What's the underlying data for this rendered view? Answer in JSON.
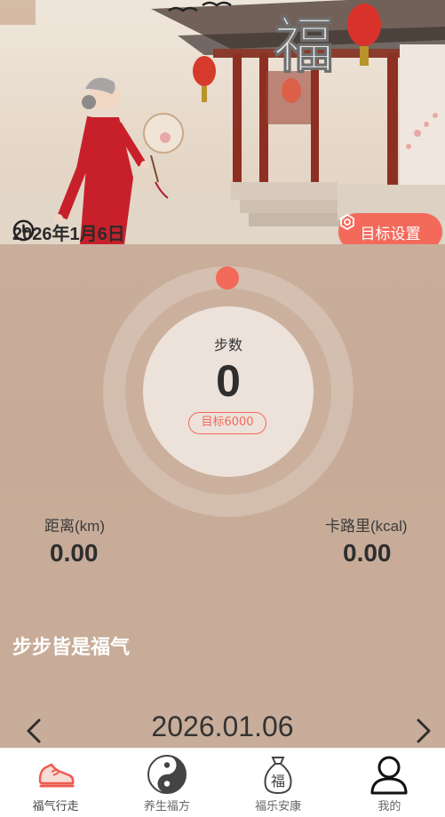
{
  "header": {
    "date": "2026年1月6日",
    "goal_button": "目标设置",
    "seal_char": "福"
  },
  "progress": {
    "label": "步数",
    "value": "0",
    "target": "目标6000",
    "fraction": 0
  },
  "stats": {
    "distance_label": "距离(km)",
    "distance_value": "0.00",
    "calorie_label": "卡路里(kcal)",
    "calorie_value": "0.00"
  },
  "motto": "步步皆是福气",
  "date_nav": {
    "date": "2026.01.06",
    "prev_icon": "chevron-left-icon",
    "next_icon": "chevron-right-icon"
  },
  "tabs": [
    {
      "label": "福气行走",
      "icon": "shoe-icon",
      "active": true
    },
    {
      "label": "养生福方",
      "icon": "yin-yang-icon",
      "active": false
    },
    {
      "label": "福乐安康",
      "icon": "fortune-bag-icon",
      "active": false
    },
    {
      "label": "我的",
      "icon": "user-icon",
      "active": false
    }
  ],
  "colors": {
    "accent": "#f36a5b",
    "background": "#c9b09c"
  }
}
